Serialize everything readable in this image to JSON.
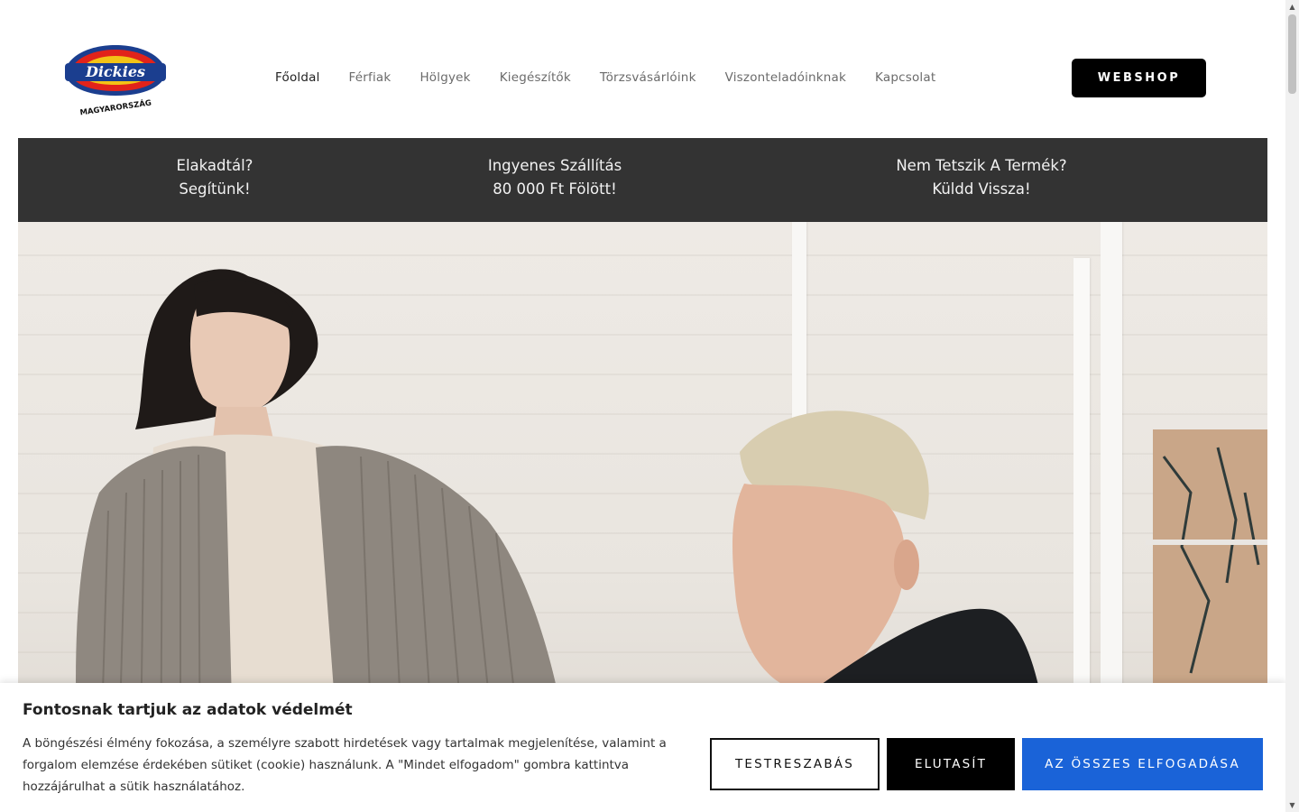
{
  "header": {
    "logo": {
      "icon": "dickies-logo",
      "brand_text": "Dickies",
      "region_text": "MAGYARORSZÁG"
    },
    "nav": [
      {
        "label": "Főoldal",
        "active": true
      },
      {
        "label": "Férfiak"
      },
      {
        "label": "Hölgyek"
      },
      {
        "label": "Kiegészítők"
      },
      {
        "label": "Törzsvásárlóink"
      },
      {
        "label": "Viszonteladóinknak"
      },
      {
        "label": "Kapcsolat"
      }
    ],
    "webshop_label": "WEBSHOP"
  },
  "info_bar": {
    "items": [
      {
        "line1": "Elakadtál?",
        "line2": "Segítünk!"
      },
      {
        "line1": "Ingyenes Szállítás",
        "line2": "80 000 Ft Fölött!"
      },
      {
        "line1": "Nem Tetszik A Termék?",
        "line2": "Küldd Vissza!"
      }
    ]
  },
  "hero": {
    "image": "hero-photo-two-models"
  },
  "cookie": {
    "title": "Fontosnak tartjuk az adatok védelmét",
    "text": "A böngészési élmény fokozása, a személyre szabott hirdetések vagy tartalmak megjelenítése, valamint a forgalom elemzése érdekében sütiket (cookie) használunk. A \"Mindet elfogadom\" gombra kattintva hozzájárulhat a sütik használatához.",
    "customize_label": "TESTRESZABÁS",
    "reject_label": "ELUTASÍT",
    "accept_label": "AZ ÖSSZES ELFOGADÁSA"
  },
  "colors": {
    "info_bar_bg": "#333333",
    "accept_blue": "#1a63d8",
    "black": "#000000"
  }
}
